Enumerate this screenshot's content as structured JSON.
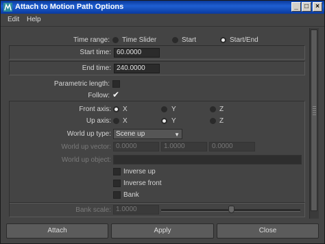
{
  "window": {
    "title": "Attach to Motion Path Options",
    "minimize": "_",
    "maximize": "□",
    "close": "×"
  },
  "menu": [
    "Edit",
    "Help"
  ],
  "time_range": {
    "label": "Time range:",
    "options": [
      "Time Slider",
      "Start",
      "Start/End"
    ],
    "selected": "Start/End"
  },
  "start_time": {
    "label": "Start time:",
    "value": "60.0000"
  },
  "end_time": {
    "label": "End time:",
    "value": "240.0000"
  },
  "parametric_length": {
    "label": "Parametric length:",
    "checked": false
  },
  "follow": {
    "label": "Follow:",
    "checked": true
  },
  "front_axis": {
    "label": "Front axis:",
    "options": [
      "X",
      "Y",
      "Z"
    ],
    "selected": "X"
  },
  "up_axis": {
    "label": "Up axis:",
    "options": [
      "X",
      "Y",
      "Z"
    ],
    "selected": "Y"
  },
  "world_up_type": {
    "label": "World up type:",
    "value": "Scene up"
  },
  "world_up_vector": {
    "label": "World up vector:",
    "values": [
      "0.0000",
      "1.0000",
      "0.0000"
    ]
  },
  "world_up_object": {
    "label": "World up object:",
    "value": ""
  },
  "inverse_up": {
    "label": "Inverse up",
    "checked": false
  },
  "inverse_front": {
    "label": "Inverse front",
    "checked": false
  },
  "bank": {
    "label": "Bank",
    "checked": false
  },
  "bank_scale": {
    "label": "Bank scale:",
    "value": "1.0000",
    "slider_fraction": 0.5
  },
  "buttons": {
    "attach": "Attach",
    "apply": "Apply",
    "close": "Close"
  },
  "colors": {
    "titlebar": "#1f5fd1",
    "background": "#444444",
    "field": "#2b2b2b",
    "button": "#5b5b5b"
  }
}
